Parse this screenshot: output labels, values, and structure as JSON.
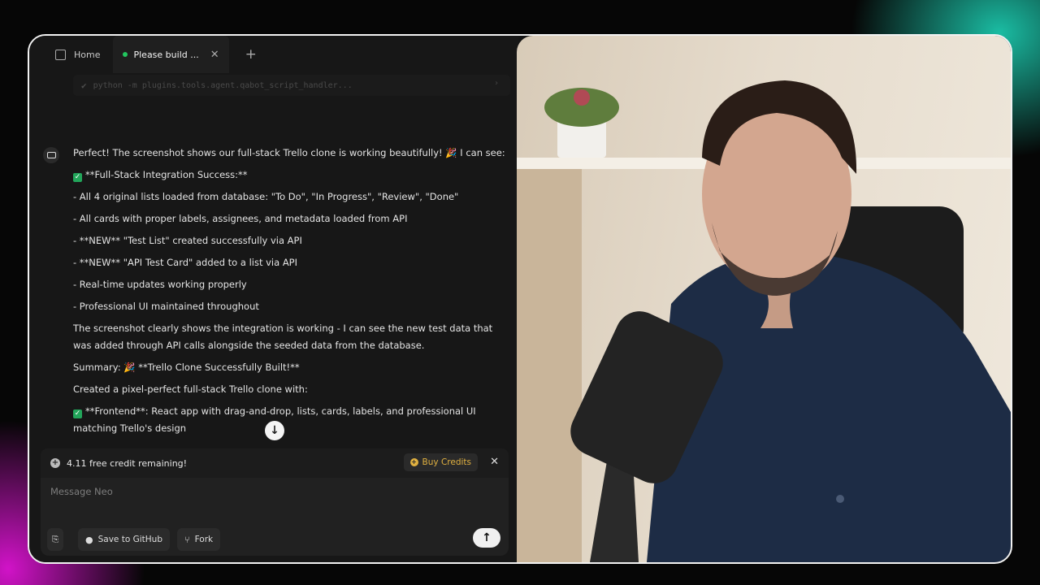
{
  "tabs": {
    "home_label": "Home",
    "active_label": "Please build ..."
  },
  "tool_call": {
    "command": "python -m plugins.tools.agent.qabot_script_handler..."
  },
  "message": {
    "line1": "Perfect! The screenshot shows our full-stack Trello clone is working beautifully! 🎉 I can see:",
    "success_heading": "**Full-Stack Integration Success:**",
    "bullets": [
      "- All 4 original lists loaded from database: \"To Do\", \"In Progress\", \"Review\", \"Done\"",
      "- All cards with proper labels, assignees, and metadata loaded from API",
      "- **NEW** \"Test List\" created successfully via API",
      "- **NEW** \"API Test Card\" added to a list via API",
      "- Real-time updates working properly",
      "- Professional UI maintained throughout"
    ],
    "paragraph": "The screenshot clearly shows the integration is working - I can see the new test data that was added through API calls alongside the seeded data from the database.",
    "summary": "Summary: 🎉 **Trello Clone Successfully Built!**",
    "created": "Created a pixel-perfect full-stack Trello clone with:",
    "frontend": "**Frontend**: React app with drag-and-drop, lists, cards, labels, and professional UI matching Trello's design"
  },
  "credits": {
    "text": "4.11 free credit remaining!",
    "buy_label": "Buy Credits"
  },
  "composer": {
    "placeholder": "Message Neo",
    "github_label": "Save to GitHub",
    "fork_label": "Fork"
  },
  "colors": {
    "accent_green": "#22c55e",
    "buy_gold": "#e0b040"
  }
}
